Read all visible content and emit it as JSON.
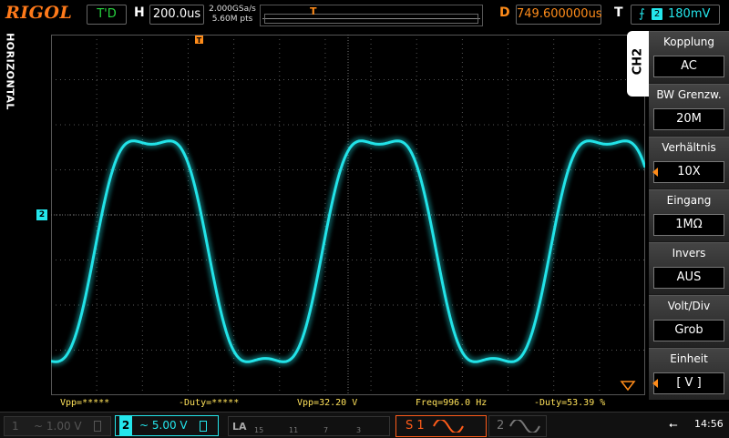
{
  "top": {
    "logo": "RIGOL",
    "run_state": "T'D",
    "h_label": "H",
    "timebase": "200.0us",
    "sample_rate": "2.000GSa/s",
    "mem_depth": "5.60M pts",
    "d_label": "D",
    "delay": "749.600000us",
    "t_label": "T",
    "trigger_channel": "2",
    "trigger_level": "180mV",
    "colors": {
      "logo": "#ff7a1a",
      "run": "#27d43f",
      "trigger": "#24e6ec"
    }
  },
  "left_tab": "HORIZONTAL",
  "channel_tab": "CH2",
  "channel_marker": "2",
  "menu": [
    {
      "title": "Kopplung",
      "value": "AC",
      "has_arrow": false
    },
    {
      "title": "BW Grenzw.",
      "value": "20M",
      "has_arrow": false
    },
    {
      "title": "Verhältnis",
      "value": "10X",
      "has_arrow": true
    },
    {
      "title": "Eingang",
      "value": "1MΩ",
      "has_arrow": false
    },
    {
      "title": "Invers",
      "value": "AUS",
      "has_arrow": false
    },
    {
      "title": "Volt/Div",
      "value": "Grob",
      "has_arrow": false
    },
    {
      "title": "Einheit",
      "value": "[ V ]",
      "has_arrow": true
    }
  ],
  "measurements": {
    "vpp_ch1": "Vpp=*****",
    "duty_ch1": "-Duty=*****",
    "vpp_ch2": "Vpp=32.20 V",
    "freq": "Freq=996.0 Hz",
    "duty_ch2": "-Duty=53.39 %"
  },
  "bottom": {
    "ch1_num": "1",
    "ch1_scale": "~ 1.00 V",
    "ch2_num": "2",
    "ch2_scale": "~ 5.00 V",
    "la_label": "LA",
    "la_numbers": [
      "15",
      "11",
      "7",
      "3"
    ],
    "source1": "S 1",
    "source2": "2",
    "time": "14:56"
  },
  "trace_color": "#22e3e8"
}
